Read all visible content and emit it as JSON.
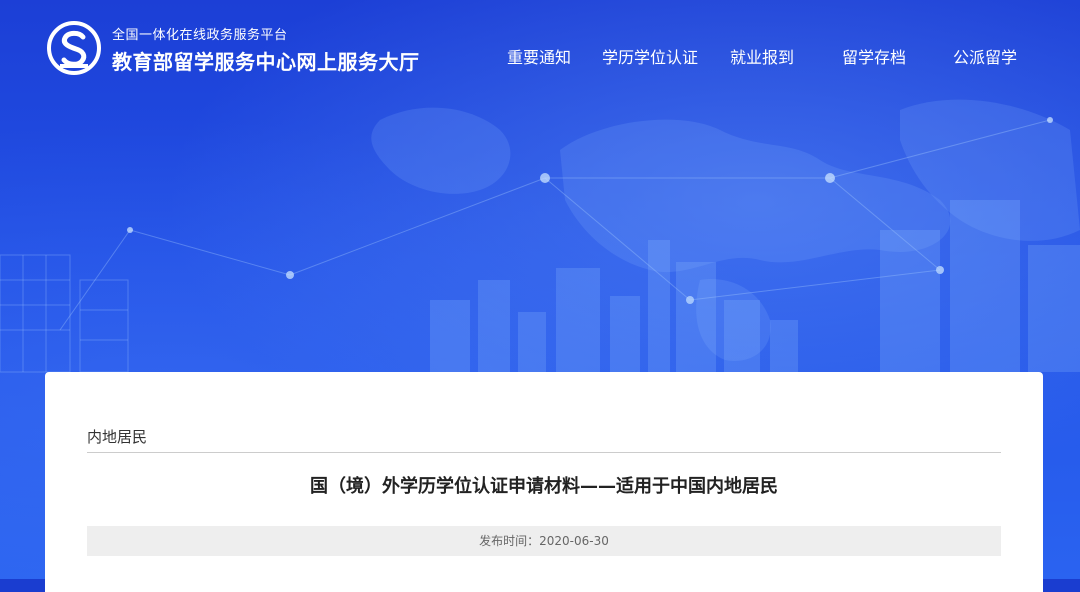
{
  "header": {
    "logo_icon": "service-center-logo",
    "platform_subtitle": "全国一体化在线政务服务平台",
    "site_title": "教育部留学服务中心网上服务大厅"
  },
  "nav": {
    "items": [
      {
        "label": "重要通知"
      },
      {
        "label": "学历学位认证"
      },
      {
        "label": "就业报到"
      },
      {
        "label": "留学存档"
      },
      {
        "label": "公派留学"
      }
    ]
  },
  "content": {
    "breadcrumb": "内地居民",
    "title": "国（境）外学历学位认证申请材料——适用于中国内地居民",
    "publish_label": "发布时间：",
    "publish_date": "2020-06-30"
  },
  "colors": {
    "banner_blue": "#1c3fd6",
    "card_bg": "#ffffff",
    "meta_bg": "#eeeeee"
  }
}
